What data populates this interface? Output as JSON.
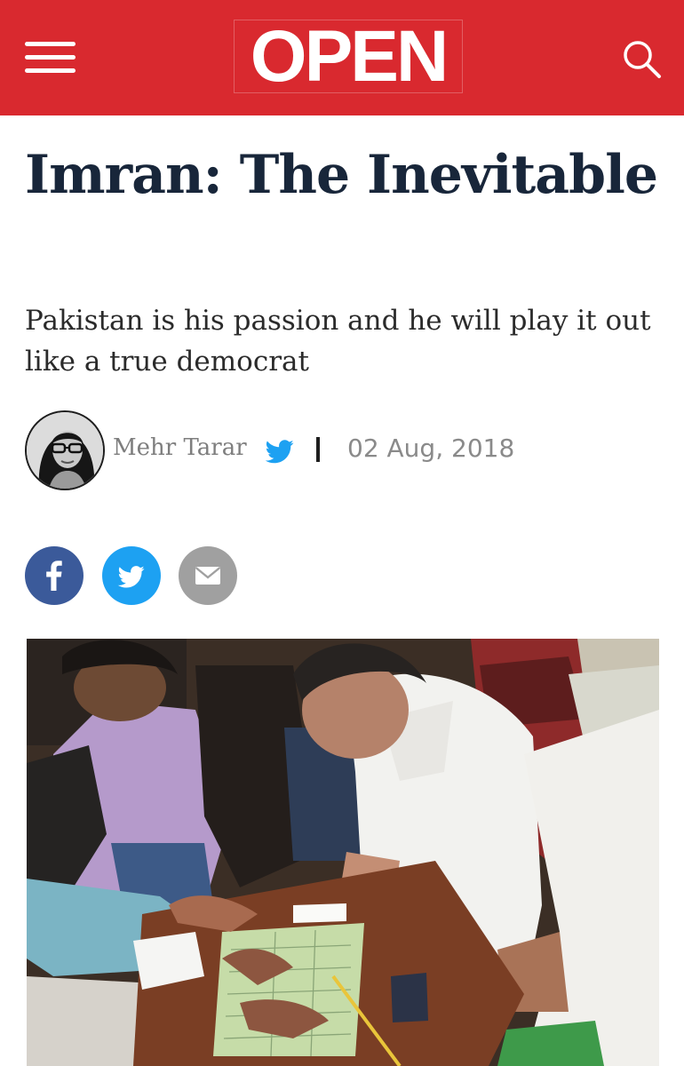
{
  "header": {
    "logo_text": "OPEN",
    "brand_color": "#d9292f",
    "menu_icon": "hamburger-menu-icon",
    "search_icon": "search-icon"
  },
  "article": {
    "title": "Imran: The Inevitable",
    "subtitle": "Pakistan is his passion and he will play it out like a true democrat",
    "author": "Mehr Tarar",
    "date": "02 Aug, 2018",
    "author_social_icon": "twitter-icon"
  },
  "share": {
    "icons": [
      "facebook-icon",
      "twitter-icon",
      "email-icon"
    ],
    "colors": [
      "#3b5a9a",
      "#1da1f2",
      "#a0a0a0"
    ]
  },
  "colors": {
    "title": "#18263a",
    "meta_text": "#8a8a8a"
  }
}
